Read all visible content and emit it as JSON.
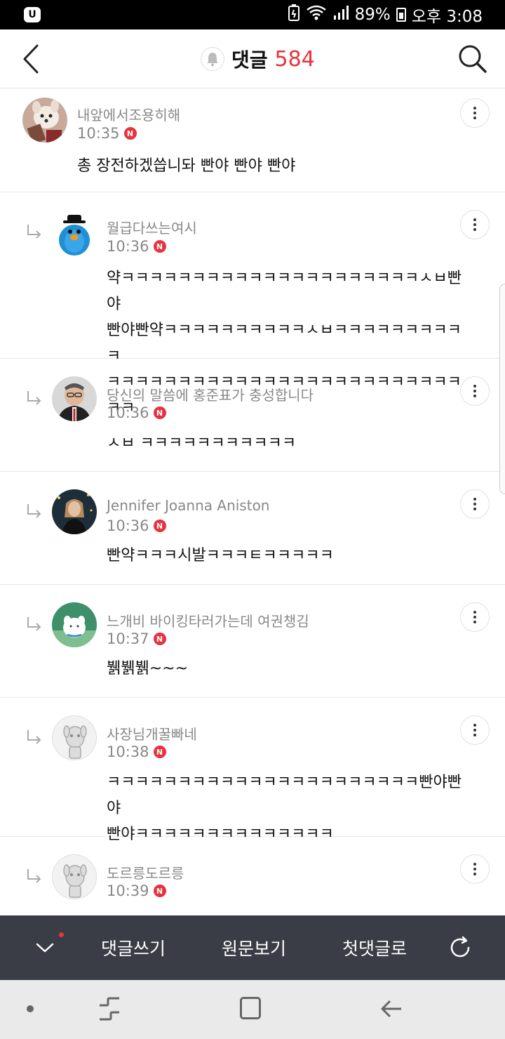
{
  "status_bar": {
    "battery_percent": "89%",
    "time": "오후 3:08"
  },
  "header": {
    "title": "댓글",
    "count": "584"
  },
  "comments": [
    {
      "author": "내앞에서조용히해",
      "time": "10:35",
      "badge": "N",
      "text": "총 장전하겠씁니돠 빤야 빤야 빤야",
      "reply": false
    },
    {
      "author": "월급다쓰는여시",
      "time": "10:36",
      "badge": "N",
      "text": "약ㅋㅋㅋㅋㅋㅋㅋㅋㅋㅋㅋㅋㅋㅋㅋㅋㅋㅋㅋㅋㅋㅅㅂ빤야\n빤야빤약ㅋㅋㅋㅋㅋㅋㅋㅋㅋㅋㅅㅂㅋㅋㅋㅋㅋㅋㅋㅋㅋㅋ\nㅋㅋㅋㅋㅋㅋㅋㅋㅋㅋㅋㅋㅋㅋㅋㅋㅋㅋㅋㅋㅋㅋㅋㅋㅋㅋㅋ",
      "reply": true
    },
    {
      "author": "당신의 말씀에 홍준표가 충성합니다",
      "time": "10:36",
      "badge": "N",
      "text": "ㅅㅂ ㅋㅋㅋㅋㅋㅋㅋㅋㅋㅋㅋ",
      "reply": true
    },
    {
      "author": "Jennifer Joanna Aniston",
      "time": "10:36",
      "badge": "N",
      "text": "빤약ㅋㅋㅋ시발ㅋㅋㅋㅌㅋㅋㅋㅋㅋ",
      "reply": true
    },
    {
      "author": "느개비 바이킹타러가는데 여권챙김",
      "time": "10:37",
      "badge": "N",
      "text": "뷁뷁뷁~~~",
      "reply": true
    },
    {
      "author": "사장님개꿀빠네",
      "time": "10:38",
      "badge": "N",
      "text": "ㅋㅋㅋㅋㅋㅋㅋㅋㅋㅋㅋㅋㅋㅋㅋㅋㅋㅋㅋㅋㅋㅋ빤야빤야\n빤야ㅋㅋㅋㅋㅋㅋㅋㅋㅋㅋㅋㅋㅋㅋ",
      "reply": true
    },
    {
      "author": "도르릉도르릉",
      "time": "10:39",
      "badge": "N",
      "text": "",
      "reply": true
    }
  ],
  "toolbar": {
    "write_label": "댓글쓰기",
    "original_label": "원문보기",
    "first_label": "첫댓글로"
  },
  "colors": {
    "accent": "#e8323c",
    "toolbar_bg": "#3a3d45"
  }
}
